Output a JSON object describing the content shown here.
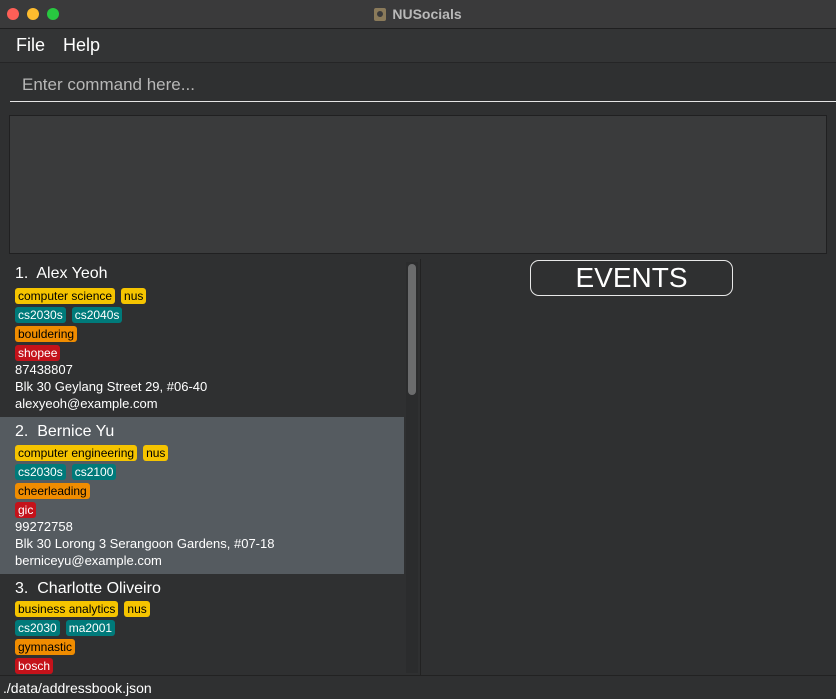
{
  "window": {
    "title": "NUSocials"
  },
  "menu": {
    "items": [
      "File",
      "Help"
    ]
  },
  "command": {
    "placeholder": "Enter command here...",
    "value": ""
  },
  "result": {
    "text": ""
  },
  "persons": [
    {
      "index": "1.",
      "name": "Alex Yeoh",
      "tag_rows": [
        [
          {
            "label": "computer science",
            "color": "yellow"
          },
          {
            "label": "nus",
            "color": "yellow"
          }
        ],
        [
          {
            "label": "cs2030s",
            "color": "teal"
          },
          {
            "label": "cs2040s",
            "color": "teal"
          }
        ],
        [
          {
            "label": "bouldering",
            "color": "orange"
          }
        ],
        [
          {
            "label": "shopee",
            "color": "red"
          }
        ]
      ],
      "phone": "87438807",
      "address": "Blk 30 Geylang Street 29, #06-40",
      "email": "alexyeoh@example.com"
    },
    {
      "index": "2.",
      "name": "Bernice Yu",
      "tag_rows": [
        [
          {
            "label": "computer engineering",
            "color": "yellow"
          },
          {
            "label": "nus",
            "color": "yellow"
          }
        ],
        [
          {
            "label": "cs2030s",
            "color": "teal"
          },
          {
            "label": "cs2100",
            "color": "teal"
          }
        ],
        [
          {
            "label": "cheerleading",
            "color": "orange"
          }
        ],
        [
          {
            "label": "gic",
            "color": "red"
          }
        ]
      ],
      "phone": "99272758",
      "address": "Blk 30 Lorong 3 Serangoon Gardens, #07-18",
      "email": "berniceyu@example.com"
    },
    {
      "index": "3.",
      "name": "Charlotte Oliveiro",
      "tag_rows": [
        [
          {
            "label": "business analytics",
            "color": "yellow"
          },
          {
            "label": "nus",
            "color": "yellow"
          }
        ],
        [
          {
            "label": "cs2030",
            "color": "teal"
          },
          {
            "label": "ma2001",
            "color": "teal"
          }
        ],
        [
          {
            "label": "gymnastic",
            "color": "orange"
          }
        ],
        [
          {
            "label": "bosch",
            "color": "red"
          }
        ]
      ],
      "phone": "",
      "address": "",
      "email": ""
    }
  ],
  "events": {
    "header": "EVENTS"
  },
  "status": {
    "path": "./data/addressbook.json"
  },
  "colors": {
    "tag_yellow": "#f5c400",
    "tag_teal": "#007a7a",
    "tag_orange": "#f08c00",
    "tag_red": "#c4121a",
    "selected_row": "#555b60"
  }
}
